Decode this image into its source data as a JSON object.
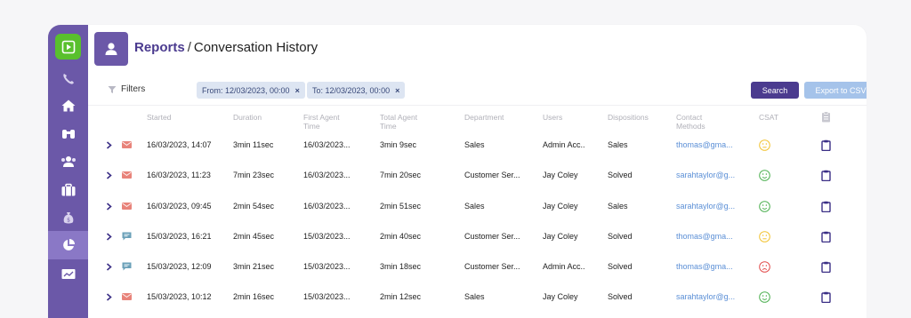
{
  "header": {
    "crumb": "Reports",
    "separator": "/",
    "current": "Conversation History"
  },
  "filters": {
    "label": "Filters",
    "chips": [
      {
        "label": "From: 12/03/2023, 00:00",
        "remove": "×"
      },
      {
        "label": "To: 12/03/2023, 00:00",
        "remove": "×"
      }
    ],
    "search_label": "Search",
    "export_label": "Export to CSV"
  },
  "table": {
    "headers": {
      "started": "Started",
      "duration": "Duration",
      "first_agent_1": "First Agent",
      "first_agent_2": "Time",
      "total_agent_1": "Total Agent",
      "total_agent_2": "Time",
      "department": "Department",
      "users": "Users",
      "dispositions": "Dispositions",
      "contact_1": "Contact",
      "contact_2": "Methods",
      "csat": "CSAT"
    },
    "rows": [
      {
        "channel": "email",
        "started": "16/03/2023, 14:07",
        "duration": "3min 11sec",
        "first_agent": "16/03/2023...",
        "total_agent": "3min 9sec",
        "department": "Sales",
        "users": "Admin Acc..",
        "disposition": "Sales",
        "contact": "thomas@gma...",
        "csat": "neutral"
      },
      {
        "channel": "email",
        "started": "16/03/2023, 11:23",
        "duration": "7min 23sec",
        "first_agent": "16/03/2023...",
        "total_agent": "7min 20sec",
        "department": "Customer Ser...",
        "users": "Jay Coley",
        "disposition": "Solved",
        "contact": "sarahtaylor@g...",
        "csat": "happy"
      },
      {
        "channel": "email",
        "started": "16/03/2023, 09:45",
        "duration": "2min 54sec",
        "first_agent": "16/03/2023...",
        "total_agent": "2min 51sec",
        "department": "Sales",
        "users": "Jay Coley",
        "disposition": "Sales",
        "contact": "sarahtaylor@g...",
        "csat": "happy"
      },
      {
        "channel": "chat",
        "started": "15/03/2023, 16:21",
        "duration": "2min 45sec",
        "first_agent": "15/03/2023...",
        "total_agent": "2min 40sec",
        "department": "Customer Ser...",
        "users": "Jay Coley",
        "disposition": "Solved",
        "contact": "thomas@gma...",
        "csat": "neutral"
      },
      {
        "channel": "chat",
        "started": "15/03/2023, 12:09",
        "duration": "3min 21sec",
        "first_agent": "15/03/2023...",
        "total_agent": "3min 18sec",
        "department": "Customer Ser...",
        "users": "Admin Acc..",
        "disposition": "Solved",
        "contact": "thomas@gma...",
        "csat": "sad"
      },
      {
        "channel": "email",
        "started": "15/03/2023, 10:12",
        "duration": "2min 16sec",
        "first_agent": "15/03/2023...",
        "total_agent": "2min 12sec",
        "department": "Sales",
        "users": "Jay Coley",
        "disposition": "Solved",
        "contact": "sarahtaylor@g...",
        "csat": "happy"
      }
    ]
  },
  "colors": {
    "sidebar": "#6b58a8",
    "accent": "#4b3b8f",
    "brand_green": "#59c02d",
    "email_icon": "#e8837a",
    "chat_icon": "#6aa0b8",
    "csat_neutral": "#f2c230",
    "csat_happy": "#4cb050",
    "csat_sad": "#e24a4a"
  },
  "icons": {
    "sidebar": [
      "play-logo-icon",
      "phone-icon",
      "home-icon",
      "binoculars-icon",
      "users-icon",
      "briefcase-icon",
      "money-bag-icon",
      "pie-chart-icon",
      "monitor-chart-icon"
    ]
  }
}
